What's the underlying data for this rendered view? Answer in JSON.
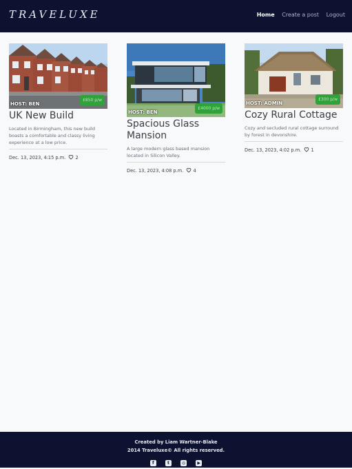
{
  "nav": {
    "brand": "TRAVELUXE",
    "links": [
      "Home",
      "Create a post",
      "Logout"
    ]
  },
  "posts": [
    {
      "host": "HOST: BEN",
      "price": "£850 p/w",
      "title": "UK New Build",
      "description": "Located in Birmingham, this new build boasts a comfortable and classy living experience at a low price.",
      "date": "Dec. 13, 2023, 4:15 p.m.",
      "likes": "2",
      "image": "red-brick-terraced-houses"
    },
    {
      "host": "HOST: BEN",
      "price": "£4000 p/w",
      "title": "Spacious Glass Mansion",
      "description": "A large modern glass based mansion located in Silicon Valley.",
      "date": "Dec. 13, 2023, 4:08 p.m.",
      "likes": "4",
      "image": "modern-glass-mansion"
    },
    {
      "host": "HOST: ADMIN",
      "price": "£300 p/w",
      "title": "Cozy Rural Cottage",
      "description": "Cozy and secluded rural cottage surround by forest in devonshire.",
      "date": "Dec. 13, 2023, 4:02 p.m.",
      "likes": "1",
      "image": "thatched-cottage"
    }
  ],
  "footer": {
    "line1": "Created by Liam Wartner-Blake",
    "line2": "2014 Traveluxe© All rights reserved.",
    "socials": [
      "facebook-icon",
      "twitter-icon",
      "instagram-icon",
      "youtube-icon"
    ]
  },
  "colors": {
    "navbar": "#0c1230",
    "price_badge": "#2fa23a",
    "background": "#f8f9fb"
  }
}
